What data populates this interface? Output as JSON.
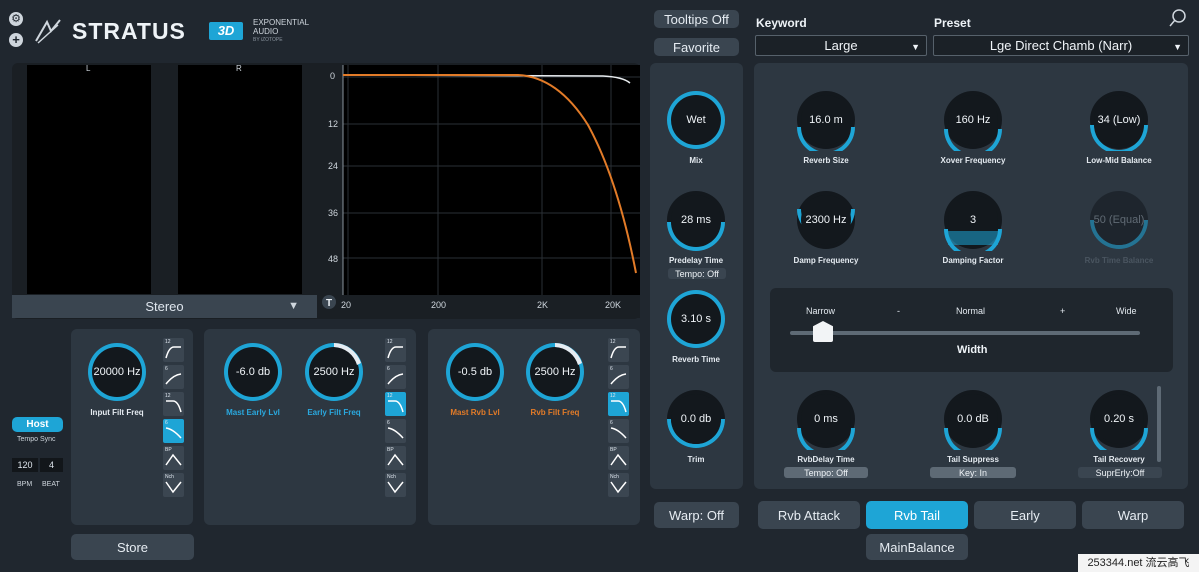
{
  "brand": {
    "name": "STRATUS",
    "badge": "3D",
    "maker": "EXPONENTIAL AUDIO",
    "maker_sub": "BY iZOTOPE"
  },
  "header_icons": [
    "gear-icon",
    "plus-icon",
    "logo-icon",
    "search-icon"
  ],
  "buttons": {
    "tooltips": "Tooltips Off",
    "favorite": "Favorite",
    "store": "Store",
    "warp_off": "Warp: Off"
  },
  "keyword": {
    "label": "Keyword",
    "value": "Large"
  },
  "preset": {
    "label": "Preset",
    "value": "Lge Direct Chamb (Narr)"
  },
  "meters": {
    "left": "L",
    "right": "R",
    "mode": "Stereo"
  },
  "eq_graph": {
    "y_ticks": [
      "0",
      "12",
      "24",
      "36",
      "48"
    ],
    "x_ticks": [
      "20",
      "200",
      "2K",
      "20K"
    ],
    "t_button": "T"
  },
  "host": {
    "button": "Host",
    "label": "Tempo Sync",
    "bpm": "120",
    "beat": "4",
    "bpm_label": "BPM",
    "beat_label": "BEAT"
  },
  "filters": {
    "input": {
      "value": "20000 Hz",
      "label": "Input Filt Freq"
    },
    "early": {
      "level": "-6.0 db",
      "level_label": "Mast Early Lvl",
      "freq": "2500 Hz",
      "freq_label": "Early Filt Freq"
    },
    "reverb": {
      "level": "-0.5 db",
      "level_label": "Mast Rvb Lvl",
      "freq": "2500 Hz",
      "freq_label": "Rvb Filt Freq"
    }
  },
  "filter_types": [
    "12",
    "6",
    "12",
    "6",
    "BP",
    "Nch"
  ],
  "middle": {
    "mix": {
      "value": "Wet",
      "label": "Mix"
    },
    "predelay": {
      "value": "28 ms",
      "label": "Predelay Time",
      "tempo": "Tempo: Off"
    },
    "reverb_time": {
      "value": "3.10 s",
      "label": "Reverb Time"
    },
    "trim": {
      "value": "0.0 db",
      "label": "Trim"
    }
  },
  "right": {
    "reverb_size": {
      "value": "16.0 m",
      "label": "Reverb Size"
    },
    "xover": {
      "value": "160 Hz",
      "label": "Xover Frequency"
    },
    "low_mid": {
      "value": "34 (Low)",
      "label": "Low-Mid Balance"
    },
    "damp_freq": {
      "value": "2300 Hz",
      "label": "Damp Frequency"
    },
    "damp_factor": {
      "value": "3",
      "label": "Damping Factor"
    },
    "rvb_time_balance": {
      "value": "50 (Equal)",
      "label": "Rvb Time Balance"
    },
    "width": {
      "narrow": "Narrow",
      "minus": "-",
      "normal": "Normal",
      "plus": "+",
      "wide": "Wide",
      "label": "Width",
      "level": 0.05
    },
    "rvbdelay": {
      "value": "0 ms",
      "label": "RvbDelay Time",
      "tempo": "Tempo: Off"
    },
    "tail_suppress": {
      "value": "0.0 dB",
      "label": "Tail Suppress",
      "key": "Key: In"
    },
    "tail_recovery": {
      "value": "0.20 s",
      "label": "Tail Recovery",
      "supr": "SuprErly:Off"
    }
  },
  "tabs": {
    "rvb_attack": "Rvb Attack",
    "rvb_tail": "Rvb Tail",
    "early": "Early",
    "warp": "Warp",
    "main_balance": "MainBalance"
  },
  "watermark": "253344.net 流云高飞",
  "colors": {
    "accent": "#1ea5d6",
    "orange": "#e27b28",
    "background": "#20272f",
    "panel": "#2d3741"
  }
}
